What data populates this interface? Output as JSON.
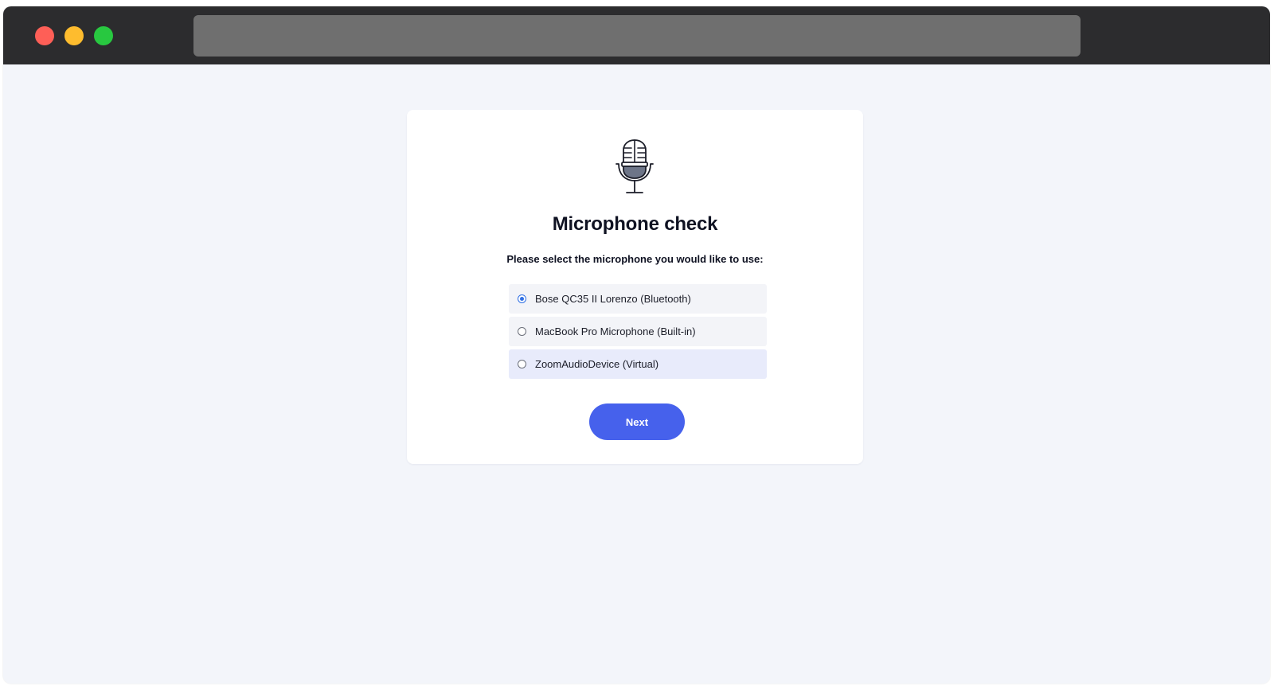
{
  "window": {
    "controls": [
      "close",
      "minimize",
      "zoom"
    ],
    "address_bar": ""
  },
  "card": {
    "icon": "microphone-icon",
    "title": "Microphone check",
    "prompt": "Please select the microphone you would like to use:",
    "options": [
      {
        "label": "Bose QC35 II Lorenzo (Bluetooth)",
        "selected": true
      },
      {
        "label": "MacBook Pro Microphone (Built-in)",
        "selected": false
      },
      {
        "label": "ZoomAudioDevice (Virtual)",
        "selected": false
      }
    ],
    "next_label": "Next"
  },
  "colors": {
    "accent": "#4661ec",
    "radio_selected": "#2f6fe4",
    "background": "#f3f5fa",
    "titlebar": "#2c2c2e"
  }
}
